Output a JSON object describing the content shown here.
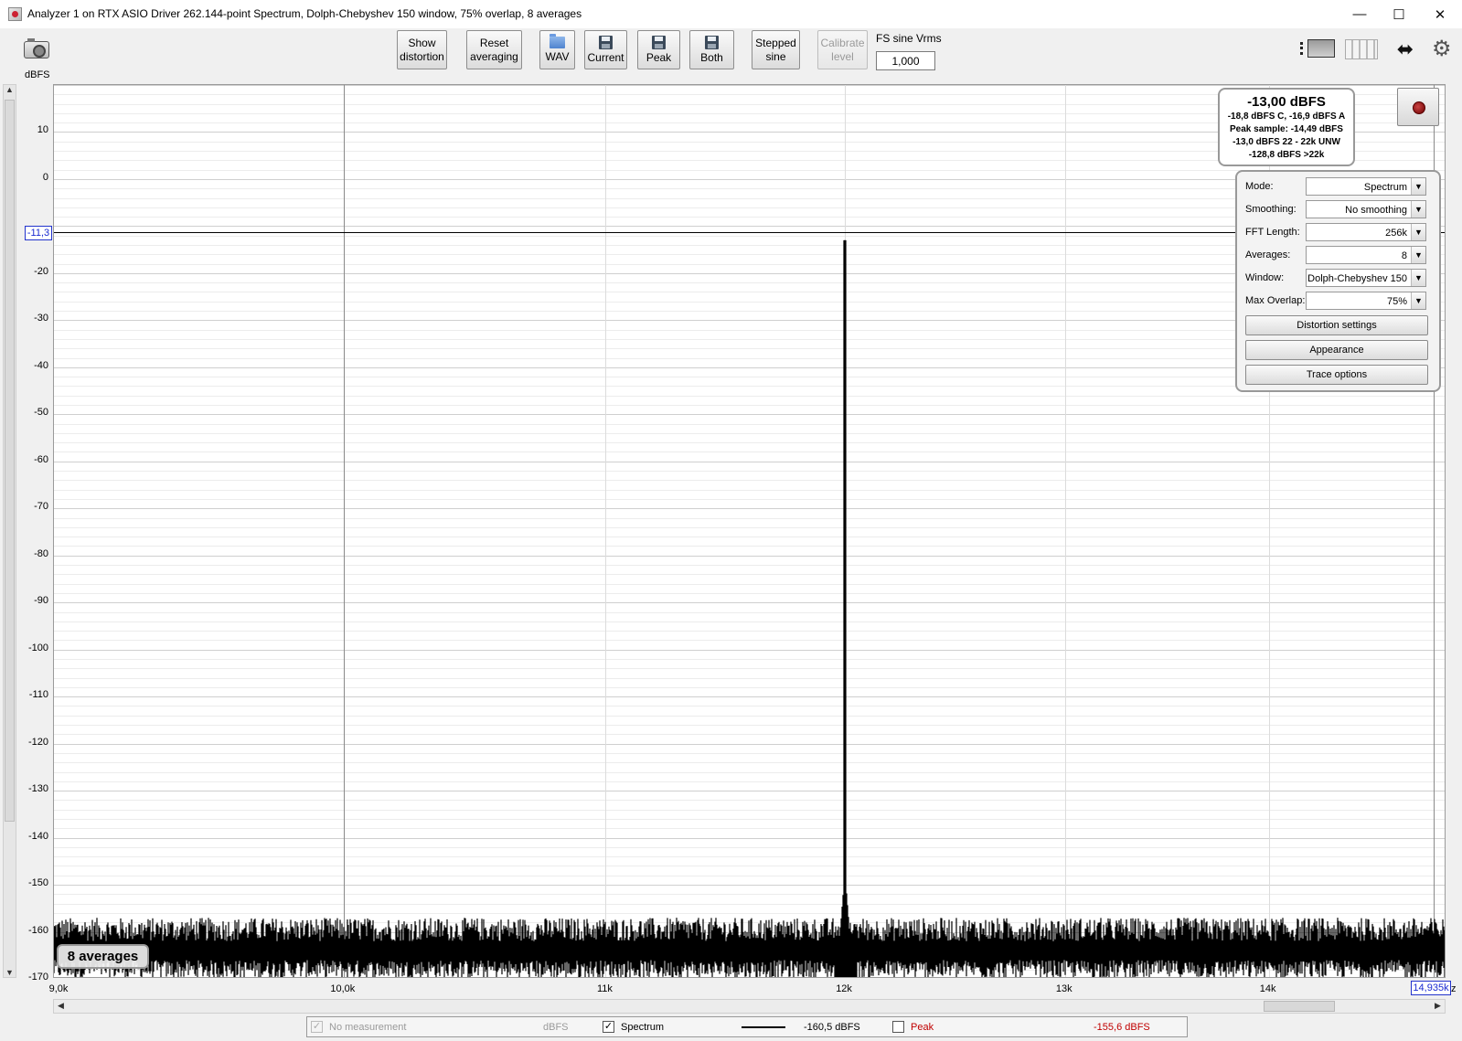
{
  "window": {
    "title": "Analyzer 1 on RTX ASIO Driver 262.144-point Spectrum, Dolph-Chebyshev 150 window, 75% overlap, 8 averages",
    "minimize": "—",
    "maximize": "☐",
    "close": "✕"
  },
  "toolbar": {
    "show_distortion": [
      "Show",
      "distortion"
    ],
    "reset_averaging": [
      "Reset",
      "averaging"
    ],
    "wav": "WAV",
    "current": "Current",
    "peak": "Peak",
    "both": "Both",
    "stepped_sine": [
      "Stepped",
      "sine"
    ],
    "calibrate_level": [
      "Calibrate",
      "level"
    ],
    "fs_label": "FS sine Vrms",
    "fs_value": "1,000"
  },
  "axes": {
    "y_unit": "dBFS",
    "y_ticks": [
      "10",
      "0",
      "-20",
      "-30",
      "-40",
      "-50",
      "-60",
      "-70",
      "-80",
      "-90",
      "-100",
      "-110",
      "-120",
      "-130",
      "-140",
      "-150",
      "-160",
      "-170"
    ],
    "ref_level": "-11,3",
    "x_ticks": [
      "9,0k",
      "10,0k",
      "11k",
      "12k",
      "13k",
      "14k"
    ],
    "x_end": "14,935k",
    "x_unit_tail": "z"
  },
  "info": {
    "main": "-13,00 dBFS",
    "lines": [
      "-18,8 dBFS C, -16,9 dBFS A",
      "Peak sample: -14,49 dBFS",
      "-13,0 dBFS 22 - 22k UNW",
      "-128,8 dBFS >22k"
    ]
  },
  "settings": {
    "rows": [
      {
        "label": "Mode:",
        "value": "Spectrum"
      },
      {
        "label": "Smoothing:",
        "value": "No  smoothing"
      },
      {
        "label": "FFT Length:",
        "value": "256k"
      },
      {
        "label": "Averages:",
        "value": "8"
      },
      {
        "label": "Window:",
        "value": "Dolph-Chebyshev 150"
      },
      {
        "label": "Max Overlap:",
        "value": "75%"
      }
    ],
    "buttons": [
      "Distortion settings",
      "Appearance",
      "Trace options"
    ]
  },
  "averages_badge": "8 averages",
  "legend": {
    "no_measurement": "No measurement",
    "no_measurement_unit": "dBFS",
    "spectrum": "Spectrum",
    "spectrum_value": "-160,5 dBFS",
    "peak": "Peak",
    "peak_value": "-155,6 dBFS",
    "check": "✓"
  },
  "colors": {
    "trace": "#000000",
    "peak_legend": "#c00000",
    "marker_blue": "#1a2bd1"
  },
  "chart_data": {
    "type": "line",
    "x_scale": "log",
    "x_range_hz": [
      9000,
      14935
    ],
    "ylim": [
      -170,
      20
    ],
    "grid": true,
    "reference_line_dbfs": -11.3,
    "series": [
      {
        "name": "Spectrum",
        "color": "#000000",
        "peak": {
          "x_hz": 12000,
          "y_dbfs": -13.0
        },
        "noise_floor_dbfs": -163,
        "noise_floor_top_dbfs": -159,
        "noise_floor_bottom_dbfs": -170
      }
    ],
    "annotations": [
      "-13,00 dBFS",
      "8 averages"
    ]
  }
}
